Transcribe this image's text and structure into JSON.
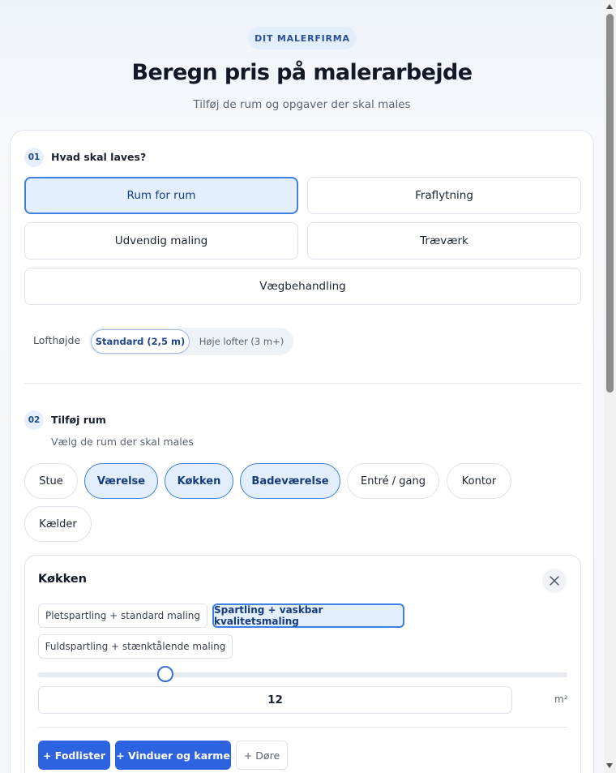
{
  "header": {
    "badge": "DIT MALERFIRMA",
    "title": "Beregn pris på malerarbejde",
    "subtitle": "Tilføj de rum og opgaver der skal males"
  },
  "step1": {
    "number": "01",
    "label": "Hvad skal laves?",
    "options": [
      {
        "label": "Rum for rum",
        "selected": true
      },
      {
        "label": "Fraflytning",
        "selected": false
      },
      {
        "label": "Udvendig maling",
        "selected": false
      },
      {
        "label": "Træværk",
        "selected": false
      },
      {
        "label": "Vægbehandling",
        "selected": false
      }
    ],
    "ceiling": {
      "label": "Lofthøjde",
      "options": [
        {
          "label": "Standard (2,5 m)",
          "selected": true
        },
        {
          "label": "Høje lofter (3 m+)",
          "selected": false
        }
      ]
    }
  },
  "step2": {
    "number": "02",
    "label": "Tilføj rum",
    "description": "Vælg de rum der skal males",
    "rooms": [
      {
        "label": "Stue",
        "selected": false
      },
      {
        "label": "Værelse",
        "selected": true
      },
      {
        "label": "Køkken",
        "selected": true
      },
      {
        "label": "Badeværelse",
        "selected": true
      },
      {
        "label": "Entré / gang",
        "selected": false
      },
      {
        "label": "Kontor",
        "selected": false
      },
      {
        "label": "Kælder",
        "selected": false
      }
    ]
  },
  "room_card": {
    "title": "Køkken",
    "close_icon": "close-icon",
    "treatments": [
      {
        "label": "Pletspartling + standard maling",
        "selected": false
      },
      {
        "label": "Spartling + vaskbar kvalitetsmaling",
        "selected": true
      },
      {
        "label": "Fuldspartling + stænktålende maling",
        "selected": false
      }
    ],
    "area": {
      "value": "12",
      "unit": "m²",
      "slider_fraction": 0.24
    },
    "add_buttons": [
      {
        "label": "+ Fodlister"
      },
      {
        "label": "+ Vinduer og karme"
      },
      {
        "label": "+ Døre"
      }
    ]
  },
  "colors": {
    "accent": "#2d63e0",
    "selected_bg": "#e3effd",
    "selected_border": "#3e7fe0"
  }
}
